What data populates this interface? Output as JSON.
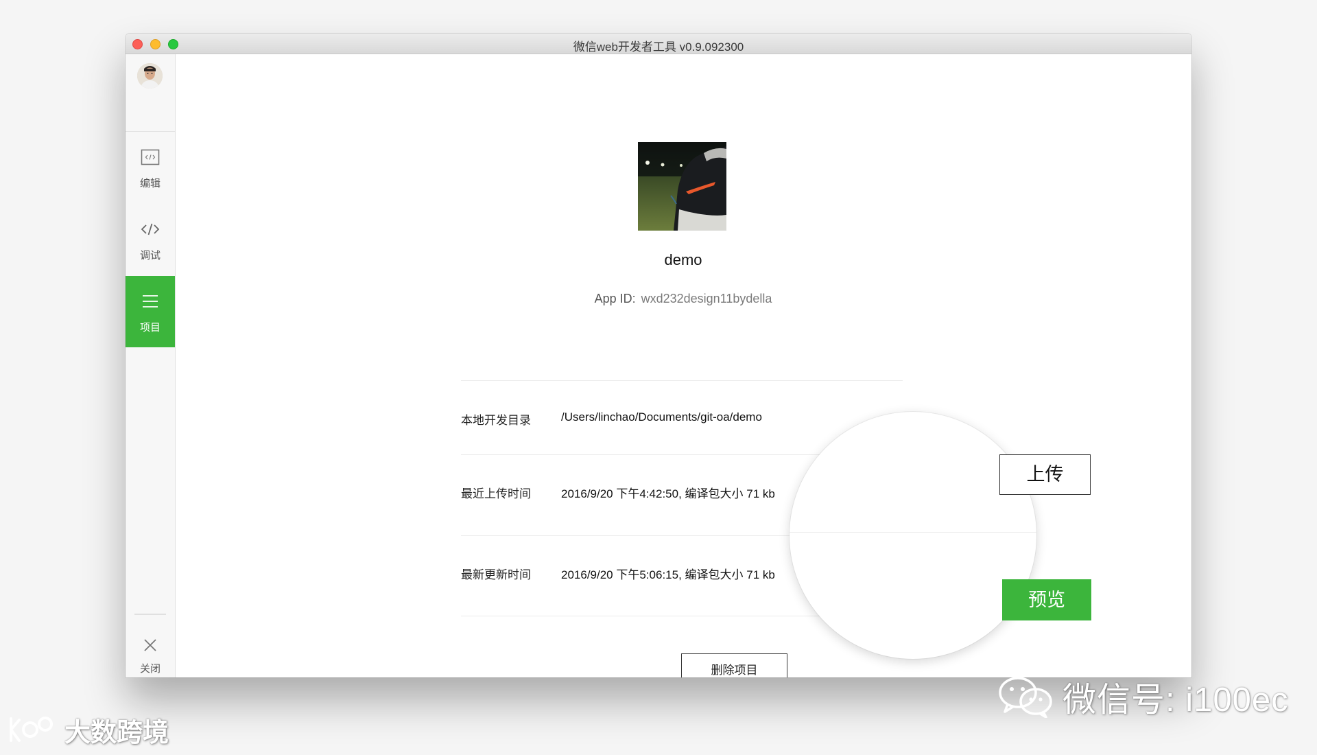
{
  "window": {
    "title": "微信web开发者工具 v0.9.092300"
  },
  "sidebar": {
    "items": [
      {
        "label": "编辑",
        "icon": "code-file-icon",
        "active": false
      },
      {
        "label": "调试",
        "icon": "code-brackets-icon",
        "active": false
      },
      {
        "label": "项目",
        "icon": "hamburger-menu-icon",
        "active": true
      }
    ],
    "close_label": "关闭"
  },
  "project": {
    "name": "demo",
    "appid_label": "App ID:",
    "appid_value": "wxd232design11bydella",
    "rows": [
      {
        "label": "本地开发目录",
        "value": "/Users/linchao/Documents/git-oa/demo"
      },
      {
        "label": "最近上传时间",
        "value": "2016/9/20 下午4:42:50, 编译包大小 71 kb"
      },
      {
        "label": "最新更新时间",
        "value": "2016/9/20 下午5:06:15, 编译包大小 71 kb"
      }
    ],
    "upload_label": "上传",
    "preview_label": "预览",
    "delete_label": "删除项目"
  },
  "watermarks": {
    "wechat_text": "微信号: i100ec",
    "brand_text": "大数跨境"
  },
  "colors": {
    "accent_green": "#3cb53c",
    "close_red": "#fc5f57",
    "minimize_yellow": "#fdbc2e",
    "maximize_green": "#28c840"
  }
}
